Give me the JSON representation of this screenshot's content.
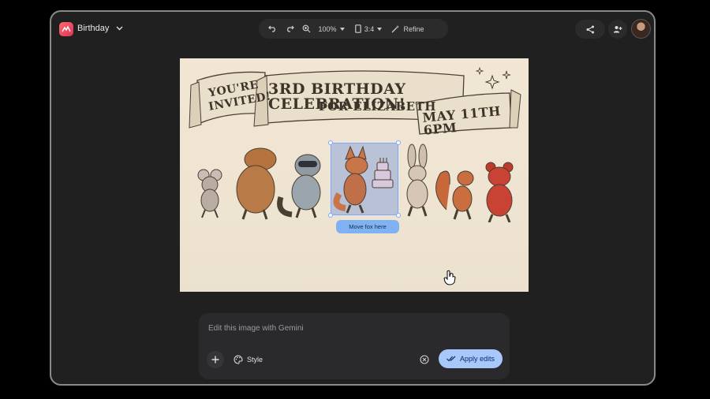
{
  "app": {
    "title": "Birthday"
  },
  "toolbar": {
    "zoom": "100%",
    "aspect_ratio": "3:4",
    "refine_label": "Refine"
  },
  "icons": {
    "undo": "undo-icon",
    "redo": "redo-icon",
    "zoom": "zoom-in-icon",
    "aspect": "crop-portrait-icon",
    "refine": "magic-wand-icon",
    "share": "share-icon",
    "add_person": "person-add-icon",
    "plus": "plus-icon",
    "palette": "palette-icon",
    "clear": "close-circle-icon",
    "check": "double-check-icon"
  },
  "image": {
    "banner_left_line1": "You're",
    "banner_left_line2": "Invited!",
    "banner_mid_line1": "3rd Birthday Celebration!",
    "banner_mid_line2": "For Elizabeth",
    "banner_right": "May 11th 6PM",
    "selection_label": "Move fox here"
  },
  "editor": {
    "placeholder": "Edit this image with Gemini",
    "style_label": "Style",
    "apply_label": "Apply edits"
  },
  "colors": {
    "accent": "#a8c7fa",
    "selection": "#7aa7ff",
    "surface": "#202020"
  }
}
